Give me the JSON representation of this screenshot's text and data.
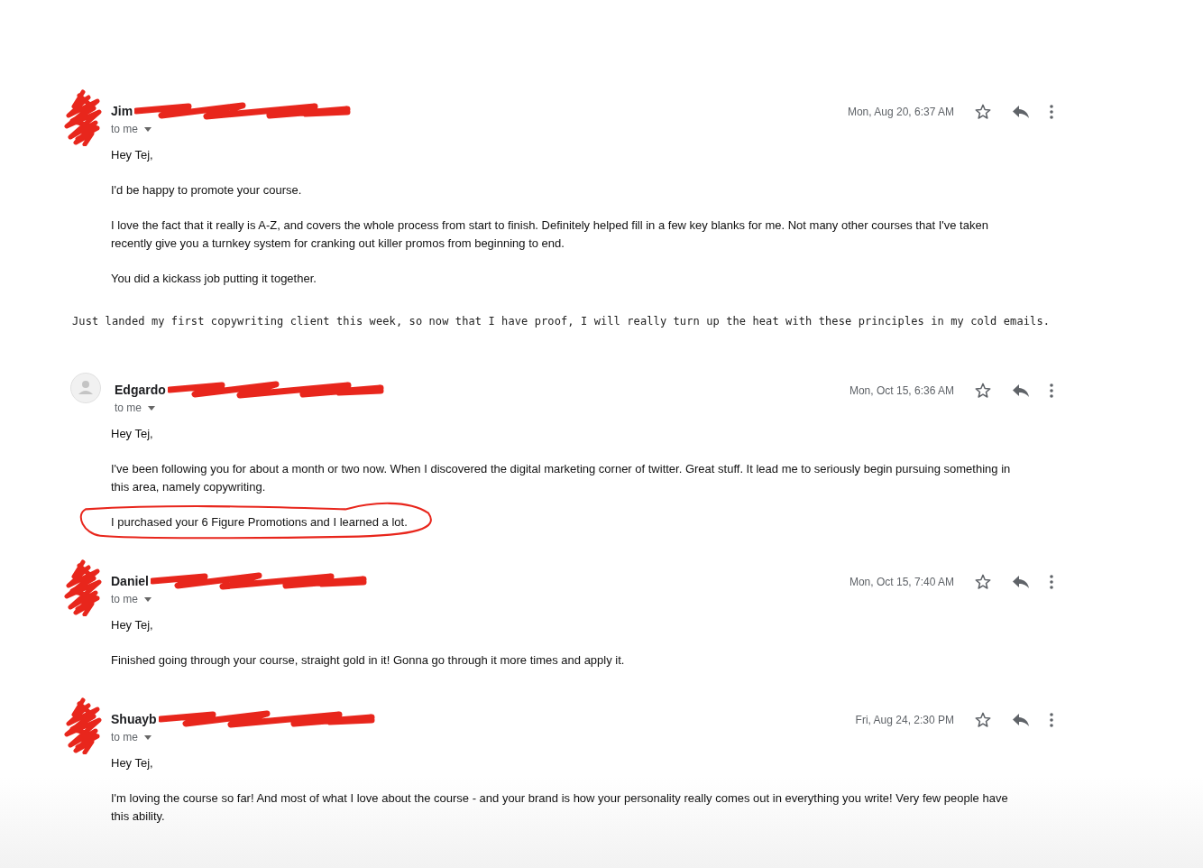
{
  "items": [
    {
      "kind": "email",
      "sender": "Jim",
      "avatar": {
        "kind": "scribble"
      },
      "redacted": true,
      "recipient": "to me",
      "date": "Mon, Aug 20, 6:37 AM",
      "paragraphs": [
        {
          "text": "Hey Tej,",
          "circled": false
        },
        {
          "text": "I'd be happy to promote your course.",
          "circled": false
        },
        {
          "text": "I love the fact that it really is A-Z, and covers the whole process from start to finish.  Definitely helped fill in a few key blanks for me. Not many other courses that I've taken recently give you a turnkey system for cranking out killer promos from beginning to end.",
          "circled": false
        },
        {
          "text": "You did a kickass job putting it together.",
          "circled": false
        }
      ]
    },
    {
      "kind": "note",
      "text": "Just landed my first copywriting client this week, so now that I have proof, I will really turn up the heat with these principles in my cold emails."
    },
    {
      "kind": "email",
      "sender": "Edgardo",
      "avatar": {
        "kind": "placeholder"
      },
      "redacted": true,
      "recipient": "to me",
      "date": "Mon, Oct 15, 6:36 AM",
      "paragraphs": [
        {
          "text": "Hey Tej,",
          "circled": false
        },
        {
          "text": "I've been following you for about a month or two now. When I discovered the digital marketing corner of twitter. Great stuff. It lead me to seriously begin pursuing something in this area, namely copywriting.",
          "circled": false
        },
        {
          "text": "I purchased your 6 Figure Promotions and I learned a lot.",
          "circled": true
        }
      ]
    },
    {
      "kind": "email",
      "sender": "Daniel",
      "avatar": {
        "kind": "scribble"
      },
      "redacted": true,
      "recipient": "to me",
      "date": "Mon, Oct 15, 7:40 AM",
      "paragraphs": [
        {
          "text": "Hey Tej,",
          "circled": false
        },
        {
          "text": "Finished going through your course, straight gold in it! Gonna go through it more times and apply it.",
          "circled": false
        }
      ]
    },
    {
      "kind": "email",
      "sender": "Shuayb",
      "avatar": {
        "kind": "scribble"
      },
      "redacted": true,
      "recipient": "to me",
      "date": "Fri, Aug 24, 2:30 PM",
      "paragraphs": [
        {
          "text": "Hey Tej,",
          "circled": false
        },
        {
          "text": "I'm loving the course so far! And most of what I love about the course - and your brand is how your personality really comes out in everything you write! Very few people have this ability.",
          "circled": false
        }
      ]
    }
  ]
}
